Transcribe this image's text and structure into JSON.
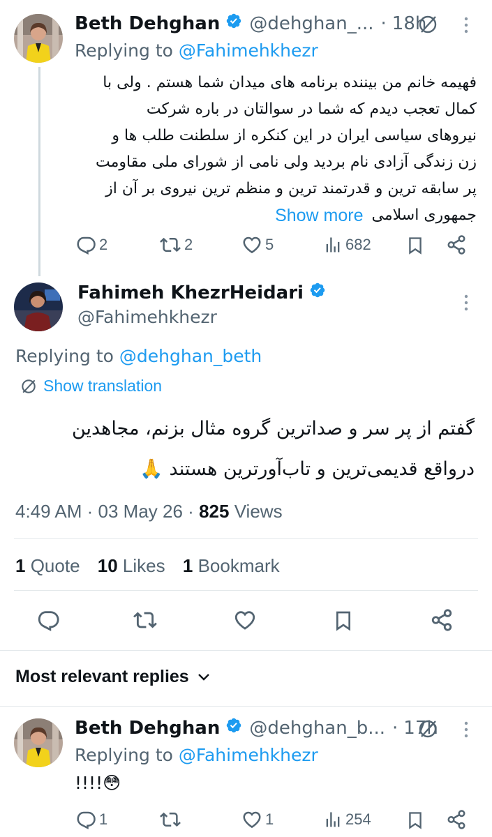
{
  "reply1": {
    "author_name": "Beth Dehghan",
    "handle": "@dehghan_...",
    "time": "18h",
    "replying_prefix": "Replying to",
    "replying_to": "@Fahimehkhezr",
    "text_lines": [
      "فهیمه خانم من بیننده برنامه های میدان شما هستم . ولی با",
      "کمال تعجب دیدم که شما در سوالتان در باره شرکت",
      "نیروهای سیاسی ایران در این کنکره از سلطنت طلب ها و",
      "زن زندگی آزادی نام بردید ولی نامی از شورای ملی مقاومت",
      "پر سابقه ترین و قدرتمند ترین و منظم ترین نیروی بر آن از"
    ],
    "last_line": "جمهوری اسلامی",
    "show_more": "Show more",
    "replies": "2",
    "reposts": "2",
    "likes": "5",
    "views": "682"
  },
  "main": {
    "author_name": "Fahimeh KhezrHeidari",
    "handle": "@Fahimehkhezr",
    "replying_prefix": "Replying to",
    "replying_to": "@dehghan_beth",
    "show_translation": "Show translation",
    "text_line1": "گفتم از پر سر و صداترین گروه مثال بزنم، مجاهدین",
    "text_line2": "درواقع قدیمی‌ترین و تاب‌آورترین هستند 🙏",
    "time": "4:49 AM",
    "date": "03 May 26",
    "views_count": "825",
    "views_label": "Views",
    "quotes_count": "1",
    "quotes_label": "Quote",
    "likes_count": "10",
    "likes_label": "Likes",
    "bookmarks_count": "1",
    "bookmarks_label": "Bookmark"
  },
  "sort_label": "Most relevant replies",
  "reply2": {
    "author_name": "Beth Dehghan",
    "handle": "@dehghan_b...",
    "time": "17h",
    "replying_prefix": "Replying to",
    "replying_to": "@Fahimehkhezr",
    "text": "!!!!😳",
    "replies": "1",
    "likes": "1",
    "views": "254"
  },
  "colors": {
    "accent": "#1d9bf0",
    "muted": "#536471",
    "text": "#0f1419",
    "divider": "#e3e8eb"
  },
  "icons": [
    "verified-badge-icon",
    "grok-slash-icon",
    "more-vertical-icon",
    "reply-icon",
    "repost-icon",
    "like-icon",
    "views-icon",
    "bookmark-icon",
    "share-icon",
    "chevron-down-icon",
    "translate-icon"
  ]
}
